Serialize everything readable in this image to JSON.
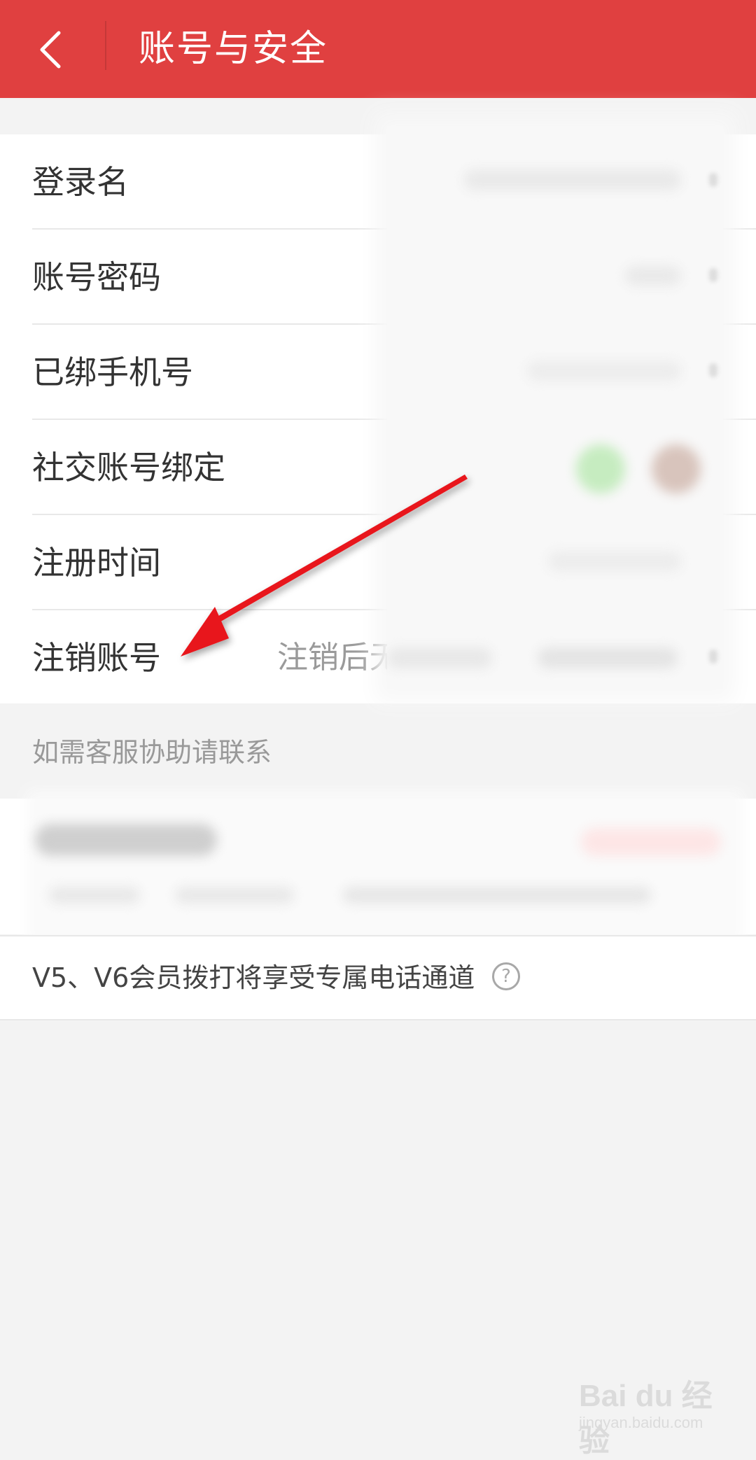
{
  "header": {
    "title": "账号与安全",
    "back_icon": "chevron-left-icon",
    "background": "#e04040"
  },
  "settings": {
    "items": [
      {
        "label": "登录名"
      },
      {
        "label": "账号密码"
      },
      {
        "label": "已绑手机号"
      },
      {
        "label": "社交账号绑定"
      },
      {
        "label": "注册时间"
      },
      {
        "label": "注销账号",
        "hint": "注销后无"
      }
    ]
  },
  "support": {
    "section_title": "如需客服协助请联系",
    "vip_note": "V5、V6会员拨打将享受专属电话通道",
    "help_icon": "question-circle-icon",
    "help_symbol": "?"
  },
  "annotation": {
    "arrow_color": "#e8121a"
  },
  "watermark": {
    "logo": "Bai du 经验",
    "url": "jingyan.baidu.com"
  }
}
